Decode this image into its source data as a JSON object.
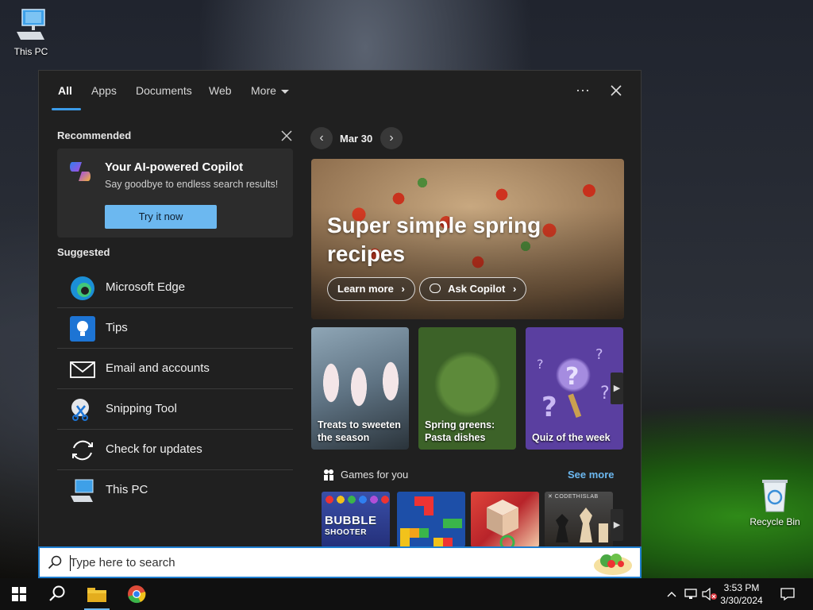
{
  "desktop": {
    "icons": [
      {
        "label": "This PC",
        "icon": "this-pc-icon"
      },
      {
        "label": "Recycle Bin",
        "icon": "recycle-bin-icon"
      }
    ]
  },
  "search_panel": {
    "tabs": [
      {
        "label": "All",
        "active": true
      },
      {
        "label": "Apps"
      },
      {
        "label": "Documents"
      },
      {
        "label": "Web"
      },
      {
        "label": "More"
      }
    ],
    "more_options_icon": "ellipsis-icon",
    "close_icon": "close-icon",
    "recommended": {
      "title": "Recommended",
      "card": {
        "title": "Your AI-powered Copilot",
        "subtitle": "Say goodbye to endless search results!",
        "button": "Try it now",
        "icon": "copilot-icon"
      }
    },
    "suggested": {
      "title": "Suggested",
      "items": [
        {
          "label": "Microsoft Edge",
          "icon": "edge-icon"
        },
        {
          "label": "Tips",
          "icon": "tips-icon"
        },
        {
          "label": "Email and accounts",
          "icon": "mail-icon"
        },
        {
          "label": "Snipping Tool",
          "icon": "snipping-tool-icon"
        },
        {
          "label": "Check for updates",
          "icon": "refresh-icon"
        },
        {
          "label": "This PC",
          "icon": "this-pc-icon"
        }
      ]
    },
    "highlights": {
      "date": "Mar 30",
      "hero": {
        "title": "Super simple spring recipes",
        "learn_more": "Learn more",
        "ask_copilot": "Ask Copilot"
      },
      "tiles": [
        {
          "caption": "Treats to sweeten the season"
        },
        {
          "caption": "Spring greens: Pasta dishes"
        },
        {
          "caption": "Quiz of the week"
        }
      ],
      "games": {
        "title": "Games for you",
        "see_more": "See more",
        "items": [
          "Bubble Shooter",
          "Block puzzle",
          "Cube game",
          "Chess"
        ]
      }
    }
  },
  "searchbox": {
    "placeholder": "Type here to search",
    "icon": "search-icon"
  },
  "taskbar": {
    "apps": [
      "start-icon",
      "search-icon",
      "file-explorer-icon",
      "chrome-icon"
    ],
    "time": "3:53 PM",
    "date": "3/30/2024",
    "tray_icons": [
      "chevron-up-icon",
      "network-icon",
      "volume-muted-icon",
      "notifications-icon"
    ]
  },
  "colors": {
    "accent": "#1f7fd1",
    "panel": "#202020",
    "link": "#6cb8f0"
  }
}
